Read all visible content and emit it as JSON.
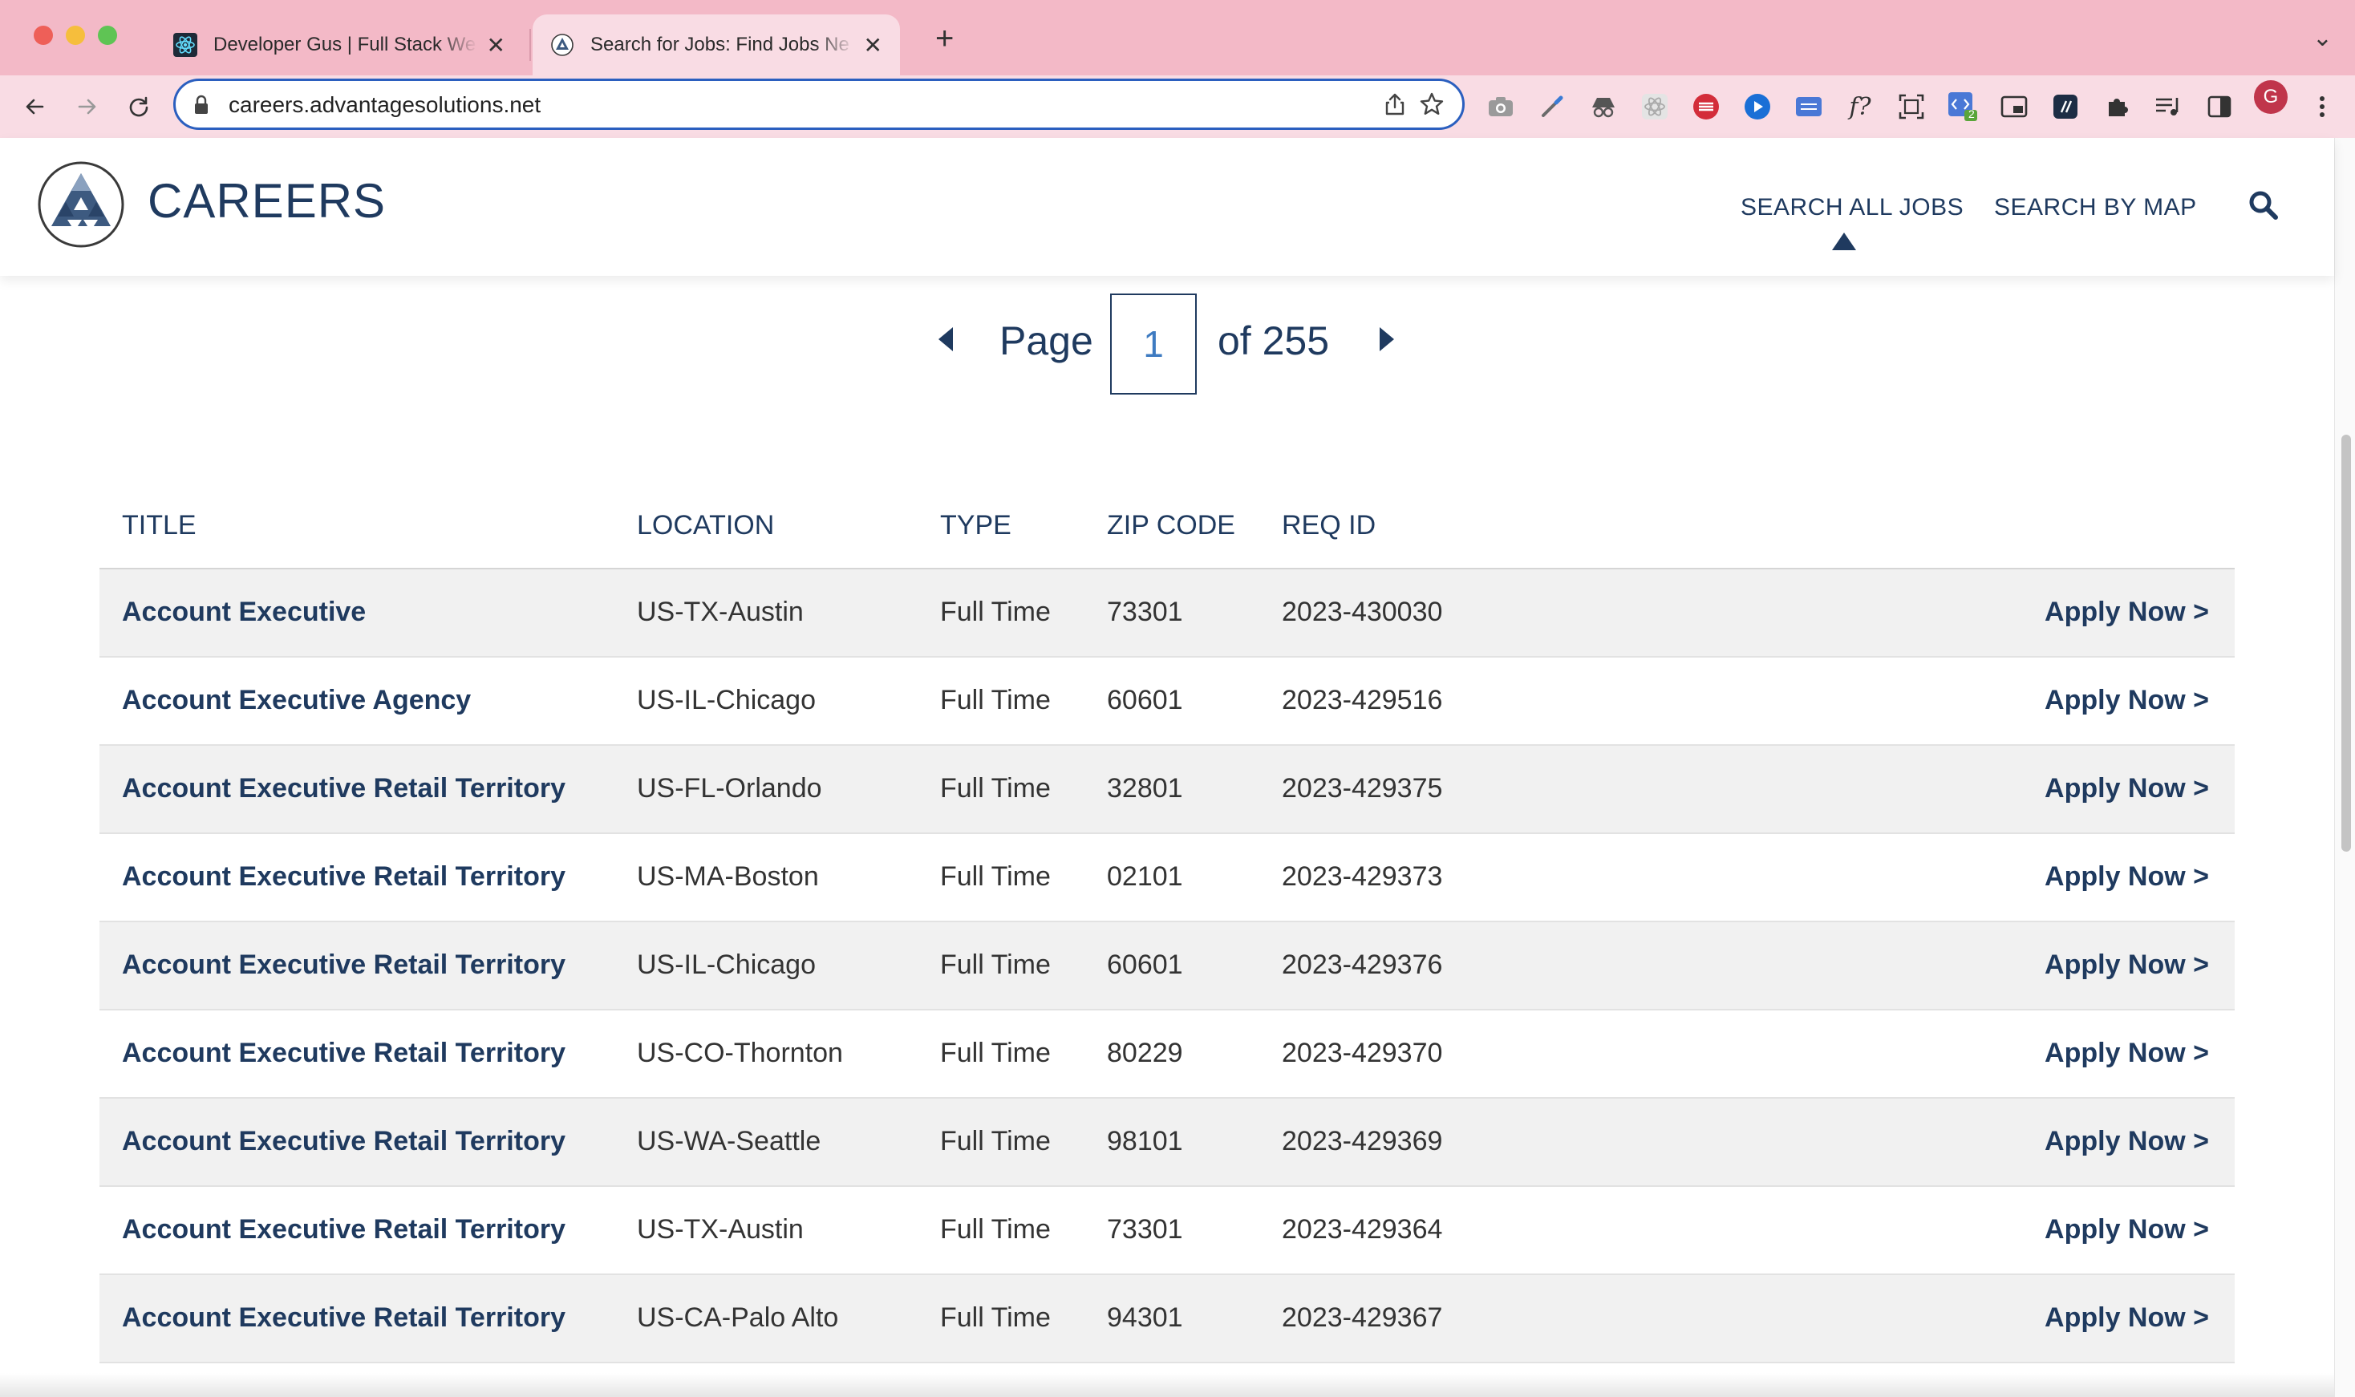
{
  "browser": {
    "tabs": [
      {
        "title": "Developer Gus | Full Stack We",
        "favicon": "react-icon",
        "active": false,
        "close": "✕"
      },
      {
        "title": "Search for Jobs: Find Jobs Ne",
        "favicon": "advantage-logo-icon",
        "active": true,
        "close": "✕"
      }
    ],
    "new_tab": "+",
    "tab_menu": "⌄",
    "url": "careers.advantagesolutions.net",
    "profile_initial": "G",
    "extension_badge": "2"
  },
  "site": {
    "brand": "CAREERS",
    "nav": {
      "search_all": "SEARCH ALL JOBS",
      "search_map": "SEARCH BY MAP"
    },
    "accent_color": "#1f3a5f"
  },
  "pagination": {
    "label": "Page",
    "current": "1",
    "total_text": "of 255"
  },
  "table": {
    "headers": {
      "title": "TITLE",
      "location": "LOCATION",
      "type": "TYPE",
      "zip": "ZIP CODE",
      "req": "REQ ID"
    },
    "apply_label": "Apply Now >",
    "rows": [
      {
        "title": "Account Executive",
        "location": "US-TX-Austin",
        "type": "Full Time",
        "zip": "73301",
        "req": "2023-430030"
      },
      {
        "title": "Account Executive Agency",
        "location": "US-IL-Chicago",
        "type": "Full Time",
        "zip": "60601",
        "req": "2023-429516"
      },
      {
        "title": "Account Executive Retail Territory",
        "location": "US-FL-Orlando",
        "type": "Full Time",
        "zip": "32801",
        "req": "2023-429375"
      },
      {
        "title": "Account Executive Retail Territory",
        "location": "US-MA-Boston",
        "type": "Full Time",
        "zip": "02101",
        "req": "2023-429373"
      },
      {
        "title": "Account Executive Retail Territory",
        "location": "US-IL-Chicago",
        "type": "Full Time",
        "zip": "60601",
        "req": "2023-429376"
      },
      {
        "title": "Account Executive Retail Territory",
        "location": "US-CO-Thornton",
        "type": "Full Time",
        "zip": "80229",
        "req": "2023-429370"
      },
      {
        "title": "Account Executive Retail Territory",
        "location": "US-WA-Seattle",
        "type": "Full Time",
        "zip": "98101",
        "req": "2023-429369"
      },
      {
        "title": "Account Executive Retail Territory",
        "location": "US-TX-Austin",
        "type": "Full Time",
        "zip": "73301",
        "req": "2023-429364"
      },
      {
        "title": "Account Executive Retail Territory",
        "location": "US-CA-Palo Alto",
        "type": "Full Time",
        "zip": "94301",
        "req": "2023-429367"
      }
    ]
  }
}
